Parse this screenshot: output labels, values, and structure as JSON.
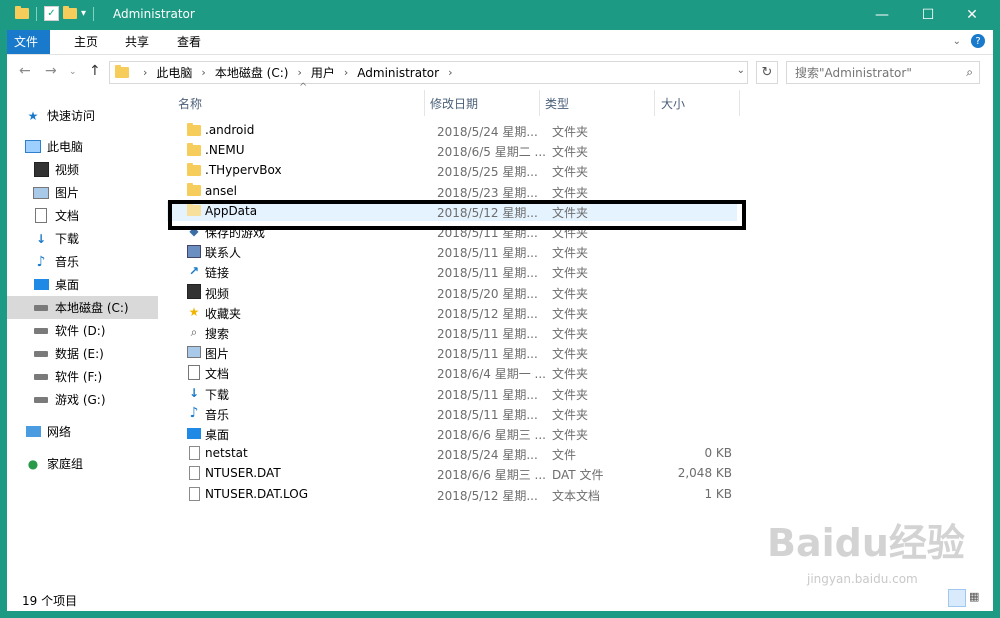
{
  "window": {
    "title": "Administrator"
  },
  "ribbon": {
    "tabs": [
      "文件",
      "主页",
      "共享",
      "查看"
    ]
  },
  "address": {
    "crumbs": [
      "此电脑",
      "本地磁盘 (C:)",
      "用户",
      "Administrator"
    ]
  },
  "search": {
    "placeholder": "搜索\"Administrator\""
  },
  "sidebar": {
    "items": [
      {
        "label": "快速访问",
        "icon": "star-icon"
      },
      {
        "label": "此电脑",
        "icon": "computer-icon"
      },
      {
        "label": "视频",
        "icon": "video-icon"
      },
      {
        "label": "图片",
        "icon": "picture-icon"
      },
      {
        "label": "文档",
        "icon": "document-icon"
      },
      {
        "label": "下载",
        "icon": "download-icon"
      },
      {
        "label": "音乐",
        "icon": "music-icon"
      },
      {
        "label": "桌面",
        "icon": "desktop-icon"
      },
      {
        "label": "本地磁盘 (C:)",
        "icon": "drive-icon",
        "selected": true
      },
      {
        "label": "软件 (D:)",
        "icon": "drive-icon"
      },
      {
        "label": "数据 (E:)",
        "icon": "drive-icon"
      },
      {
        "label": "软件 (F:)",
        "icon": "drive-icon"
      },
      {
        "label": "游戏 (G:)",
        "icon": "drive-icon"
      },
      {
        "label": "网络",
        "icon": "network-icon"
      },
      {
        "label": "家庭组",
        "icon": "homegroup-icon"
      }
    ]
  },
  "columns": {
    "name": "名称",
    "date": "修改日期",
    "type": "类型",
    "size": "大小"
  },
  "files": [
    {
      "name": ".android",
      "date": "2018/5/24 星期...",
      "type": "文件夹",
      "size": "",
      "icon": "folder-icon"
    },
    {
      "name": ".NEMU",
      "date": "2018/6/5 星期二 ...",
      "type": "文件夹",
      "size": "",
      "icon": "folder-icon"
    },
    {
      "name": ".THypervBox",
      "date": "2018/5/25 星期...",
      "type": "文件夹",
      "size": "",
      "icon": "folder-icon"
    },
    {
      "name": "ansel",
      "date": "2018/5/23 星期...",
      "type": "文件夹",
      "size": "",
      "icon": "folder-icon"
    },
    {
      "name": "AppData",
      "date": "2018/5/12 星期...",
      "type": "文件夹",
      "size": "",
      "icon": "folder-icon",
      "hidden_style": true
    },
    {
      "name": "保存的游戏",
      "date": "2018/5/11 星期...",
      "type": "文件夹",
      "size": "",
      "icon": "saved-games-icon"
    },
    {
      "name": "联系人",
      "date": "2018/5/11 星期...",
      "type": "文件夹",
      "size": "",
      "icon": "contacts-icon"
    },
    {
      "name": "链接",
      "date": "2018/5/11 星期...",
      "type": "文件夹",
      "size": "",
      "icon": "links-icon"
    },
    {
      "name": "视频",
      "date": "2018/5/20 星期...",
      "type": "文件夹",
      "size": "",
      "icon": "video-icon"
    },
    {
      "name": "收藏夹",
      "date": "2018/5/12 星期...",
      "type": "文件夹",
      "size": "",
      "icon": "favorites-icon"
    },
    {
      "name": "搜索",
      "date": "2018/5/11 星期...",
      "type": "文件夹",
      "size": "",
      "icon": "search-icon"
    },
    {
      "name": "图片",
      "date": "2018/5/11 星期...",
      "type": "文件夹",
      "size": "",
      "icon": "picture-icon"
    },
    {
      "name": "文档",
      "date": "2018/6/4 星期一 ...",
      "type": "文件夹",
      "size": "",
      "icon": "document-icon"
    },
    {
      "name": "下载",
      "date": "2018/5/11 星期...",
      "type": "文件夹",
      "size": "",
      "icon": "download-icon"
    },
    {
      "name": "音乐",
      "date": "2018/5/11 星期...",
      "type": "文件夹",
      "size": "",
      "icon": "music-icon"
    },
    {
      "name": "桌面",
      "date": "2018/6/6 星期三 ...",
      "type": "文件夹",
      "size": "",
      "icon": "desktop-icon"
    },
    {
      "name": "netstat",
      "date": "2018/5/24 星期...",
      "type": "文件",
      "size": "0 KB",
      "icon": "file-icon"
    },
    {
      "name": "NTUSER.DAT",
      "date": "2018/6/6 星期三 ...",
      "type": "DAT 文件",
      "size": "2,048 KB",
      "icon": "file-icon"
    },
    {
      "name": "NTUSER.DAT.LOG",
      "date": "2018/5/12 星期...",
      "type": "文本文档",
      "size": "1 KB",
      "icon": "file-icon"
    }
  ],
  "status": {
    "count": "19 个项目"
  },
  "watermark": {
    "main": "Baidu经验",
    "sub": "jingyan.baidu.com"
  }
}
